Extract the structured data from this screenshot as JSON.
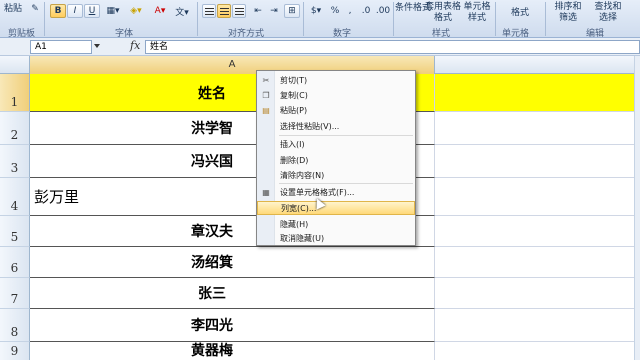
{
  "ribbon": {
    "clipboard_label": "剪贴板",
    "font_label": "字体",
    "align_label": "对齐方式",
    "number_label": "数字",
    "styles_label": "样式",
    "cells_label": "单元格",
    "edit_label": "编辑",
    "paste_label": "粘贴",
    "bold_label": "B",
    "italic_label": "I",
    "underline_label": "U",
    "cond_format_label": "条件格式",
    "table_format_label": "套用表格格式",
    "cell_style_label": "单元格样式",
    "format_label": "格式",
    "sort_filter_label": "排序和筛选",
    "find_select_label": "查找和选择"
  },
  "formula_bar": {
    "name_box": "A1",
    "fx": "fx",
    "content": "姓名"
  },
  "grid": {
    "col_a": "A",
    "rows": [
      {
        "num": "1",
        "a": "姓名"
      },
      {
        "num": "2",
        "a": "洪学智"
      },
      {
        "num": "3",
        "a": "冯兴国"
      },
      {
        "num": "4",
        "a": "彭万里"
      },
      {
        "num": "5",
        "a": "章汉夫"
      },
      {
        "num": "6",
        "a": "汤绍箕"
      },
      {
        "num": "7",
        "a": "张三"
      },
      {
        "num": "8",
        "a": "李四光"
      },
      {
        "num": "9",
        "a": "黄器梅"
      }
    ]
  },
  "context_menu": {
    "items": [
      {
        "label": "剪切(T)",
        "icon": "scissors-icon"
      },
      {
        "label": "复制(C)",
        "icon": "copy-icon"
      },
      {
        "label": "粘贴(P)",
        "icon": "paste-icon"
      },
      {
        "label": "选择性粘贴(V)...",
        "icon": ""
      },
      {
        "label": "插入(I)",
        "icon": ""
      },
      {
        "label": "删除(D)",
        "icon": ""
      },
      {
        "label": "清除内容(N)",
        "icon": ""
      },
      {
        "label": "设置单元格格式(F)...",
        "icon": "format-cells-icon"
      },
      {
        "label": "列宽(C)...",
        "icon": ""
      },
      {
        "label": "隐藏(H)",
        "icon": ""
      },
      {
        "label": "取消隐藏(U)",
        "icon": ""
      }
    ]
  },
  "colors": {
    "header_fill": "#ffff00",
    "menu_highlight": "#ffd979"
  }
}
